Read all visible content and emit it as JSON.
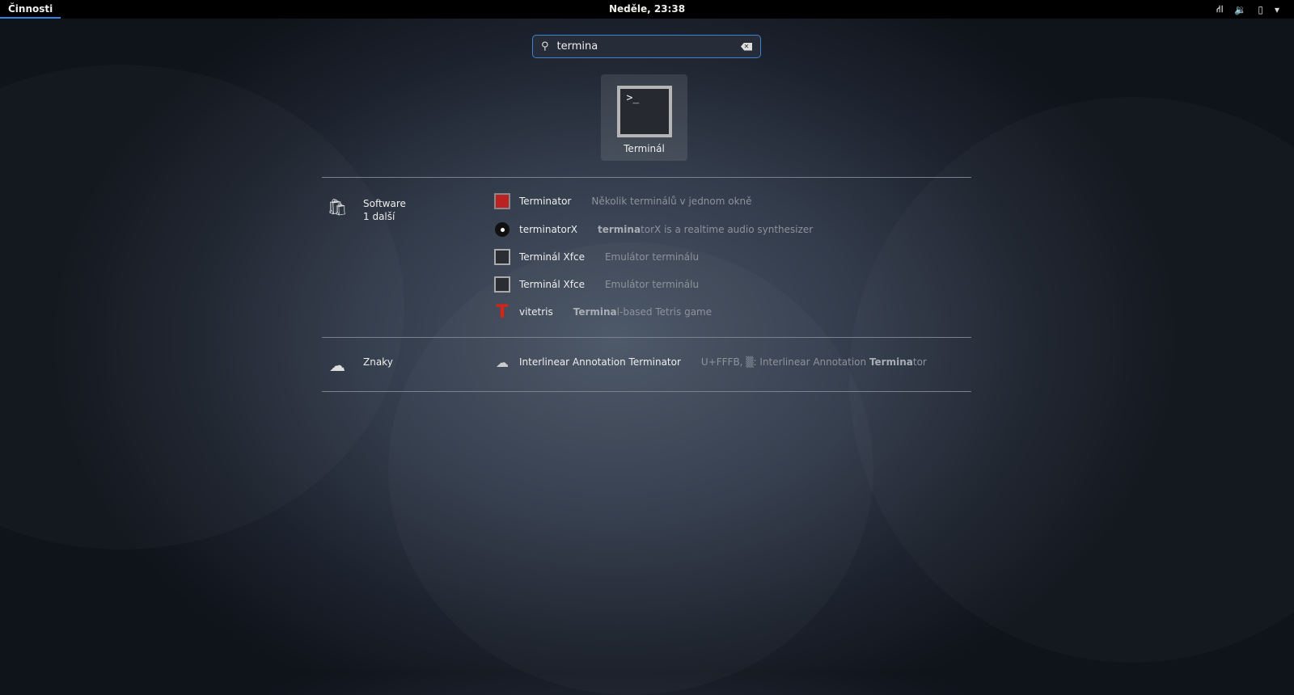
{
  "topbar": {
    "activities": "Činnosti",
    "clock": "Neděle, 23:38",
    "tray_icons": [
      "network-icon",
      "volume-icon",
      "battery-icon",
      "menu-arrow-icon"
    ]
  },
  "search": {
    "value": "termina"
  },
  "top_app": {
    "label": "Terminál",
    "icon": "terminal-icon"
  },
  "providers": [
    {
      "name": "Software",
      "more": "1 další",
      "icon": "software-bag-icon",
      "results": [
        {
          "name": "Terminator",
          "desc_pre": "Několik terminálů v jednom okně",
          "desc_bold": "",
          "desc_post": "",
          "icon": "terminator-icon"
        },
        {
          "name": "terminatorX",
          "desc_pre": "",
          "desc_bold": "termina",
          "desc_post": "torX is a realtime audio synthesizer",
          "icon": "vinyl-icon"
        },
        {
          "name": "Terminál Xfce",
          "desc_pre": "Emulátor terminálu",
          "desc_bold": "",
          "desc_post": "",
          "icon": "terminal-icon"
        },
        {
          "name": "Terminál Xfce",
          "desc_pre": "Emulátor terminálu",
          "desc_bold": "",
          "desc_post": "",
          "icon": "terminal-icon"
        },
        {
          "name": "vitetris",
          "desc_pre": "",
          "desc_bold": "Termina",
          "desc_post": "l-based Tetris game",
          "icon": "tetris-icon"
        }
      ]
    },
    {
      "name": "Znaky",
      "more": "",
      "icon": "characters-icon",
      "results": [
        {
          "name": "Interlinear Annotation Terminator",
          "desc_pre": "U+FFFB, ▒: Interlinear Annotation ",
          "desc_bold": "Termina",
          "desc_post": "tor",
          "icon": "characters-icon"
        }
      ]
    }
  ],
  "colors": {
    "accent": "#3584e4",
    "topbar": "#000000"
  }
}
